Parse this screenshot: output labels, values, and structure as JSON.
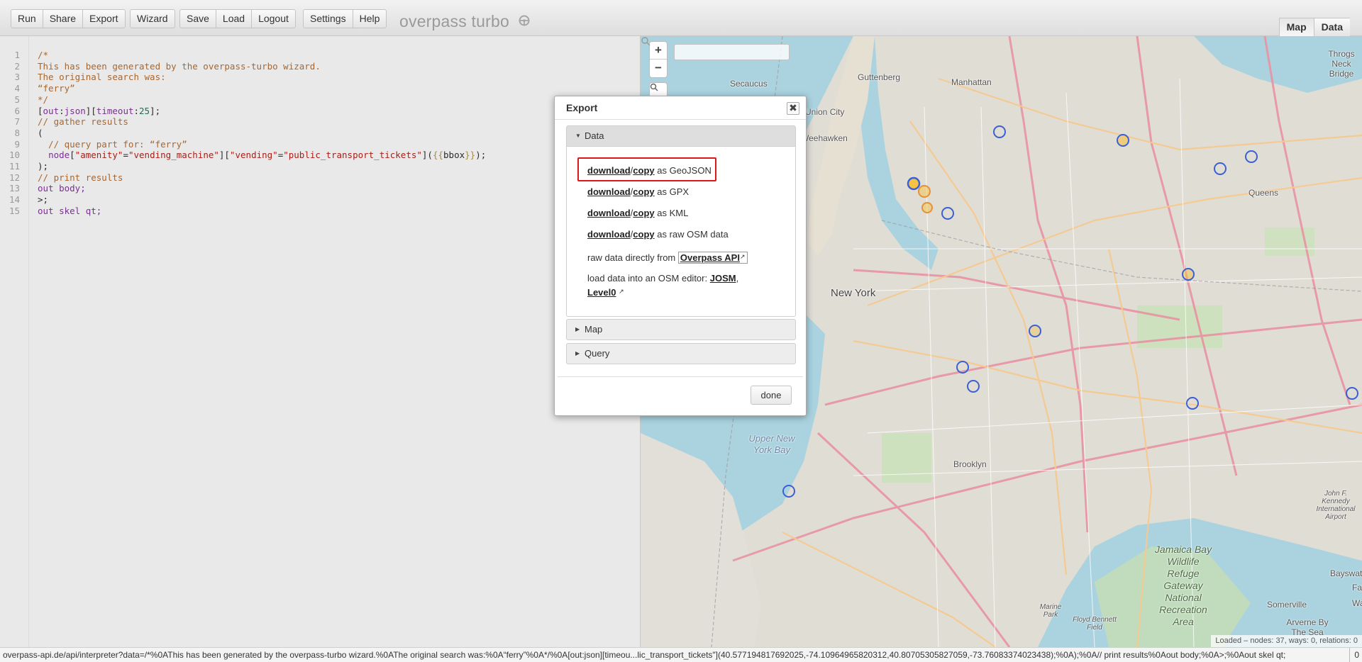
{
  "toolbar": {
    "buttons": [
      "Run",
      "Share",
      "Export",
      "Wizard",
      "Save",
      "Load",
      "Logout",
      "Settings",
      "Help"
    ],
    "app_title": "overpass turbo",
    "view_tabs": [
      "Map",
      "Data"
    ],
    "active_view": "Map"
  },
  "editor": {
    "line_numbers": [
      "1",
      "2",
      "3",
      "4",
      "5",
      "6",
      "7",
      "8",
      "9",
      "10",
      "11",
      "12",
      "13",
      "14",
      "15"
    ],
    "lines": [
      "/*",
      "This has been generated by the overpass-turbo wizard.",
      "The original search was:",
      "“ferry”",
      "*/",
      "[out:json][timeout:25];",
      "// gather results",
      "(",
      "  // query part for: “ferry”",
      "  node[\"amenity\"=\"vending_machine\"][\"vending\"=\"public_transport_tickets\"]({{bbox}});",
      ");",
      "// print results",
      "out body;",
      ">;",
      "out skel qt;"
    ]
  },
  "map": {
    "zoom_in": "+",
    "zoom_out": "−",
    "places": [
      "Secaucus",
      "Guttenberg",
      "Manhattan",
      "Throgs Neck Bridge",
      "Union City",
      "Weehawken",
      "Queens",
      "New York",
      "Upper New York Bay",
      "Brooklyn",
      "Jamaica Bay Wildlife Refuge Gateway National Recreation Area",
      "Bayswater",
      "Far",
      "Wave",
      "Somerville",
      "Arverne By The Sea",
      "John F. Kennedy International Airport",
      "Floyd Bennett Field",
      "Marine Park"
    ],
    "stats": "Loaded – nodes: 37, ways: 0, relations: 0"
  },
  "dialog": {
    "title": "Export",
    "close": "✖",
    "sections": [
      "Data",
      "Map",
      "Query"
    ],
    "open_section": "Data",
    "download": "download",
    "copy": "copy",
    "formats": [
      "as GeoJSON",
      "as GPX",
      "as KML",
      "as raw OSM data"
    ],
    "raw_prefix": "raw data directly from",
    "overpass_api": "Overpass API",
    "editor_prefix": "load data into an OSM editor:",
    "josm": "JOSM",
    "level0": "Level0",
    "done": "done"
  },
  "status": {
    "url": "overpass-api.de/api/interpreter?data=/*%0AThis has been generated by the overpass-turbo wizard.%0AThe original search was:%0A“ferry”%0A*/%0A[out:json][timeou...lic_transport_tickets\"](40.577194817692025,-74.10964965820312,40.80705305827059,-73.76083374023438);%0A);%0A// print results%0Aout body;%0A>;%0Aout skel qt;",
    "counter": "0"
  },
  "colors": {
    "highlight": "#e0181c",
    "water": "#aad3df",
    "marker_stroke": "#3b5fd6",
    "marker_fill": "#f5c243"
  }
}
